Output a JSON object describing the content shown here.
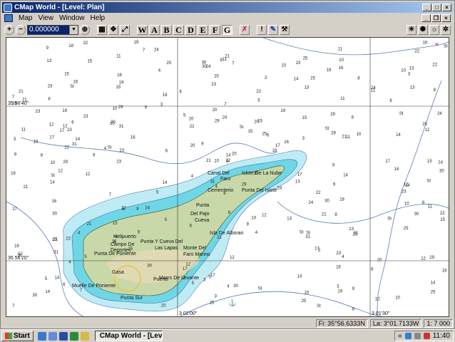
{
  "window": {
    "title": "CMap World - [Level: Plan]"
  },
  "menu": {
    "items": [
      "Map",
      "View",
      "Window",
      "Help"
    ]
  },
  "toolbar": {
    "zoom_value": "0.000000",
    "letters": [
      "W",
      "A",
      "B",
      "C",
      "D",
      "E",
      "F",
      "G"
    ],
    "active_letter": "G"
  },
  "map": {
    "lat_labels": [
      "35 56'40\"",
      "35 56'20\""
    ],
    "lon_labels": [
      "3 02'00\"",
      "3 01'30\""
    ],
    "place_names": [
      "Canal Del",
      "Islote De La Nube",
      "Faro",
      "Cementerio",
      "Punta Del Islote",
      "Punta",
      "Del Pajo",
      "Cueva",
      "Isla De Alboran",
      "Helipuerto",
      "Punta Y Cueva Del",
      "Campo De",
      "Las Lapas",
      "Deportes",
      "Monte Del",
      "Faro Marino",
      "Punta De Poniente",
      "Gasa",
      "Muelle De Poniente",
      "Puerto",
      "Morro De Levante",
      "Punta Sur"
    ],
    "soundings": [
      "St",
      "24",
      "17",
      "8",
      "15",
      "13",
      "14",
      "21",
      "16",
      "11",
      "10",
      "12",
      "19",
      "23",
      "9",
      "5",
      "7",
      "6",
      "4",
      "3",
      "18",
      "20",
      "22",
      "25",
      "31",
      "29",
      "30"
    ]
  },
  "status": {
    "lat": "Fi: 35°56.6333N",
    "lon": "La: 3°01.7133W",
    "scale": "1: 7 000"
  },
  "taskbar": {
    "start": "Start",
    "task_label": "CMap World - [Level...",
    "clock": "11:40"
  },
  "colors": {
    "land": "#c8d8a8",
    "shallow": "#6fd6e6",
    "medium": "#bfecf4",
    "deep": "#ffffff",
    "depth_line": "#5a7ab8",
    "titlebar": "#0a246a"
  }
}
